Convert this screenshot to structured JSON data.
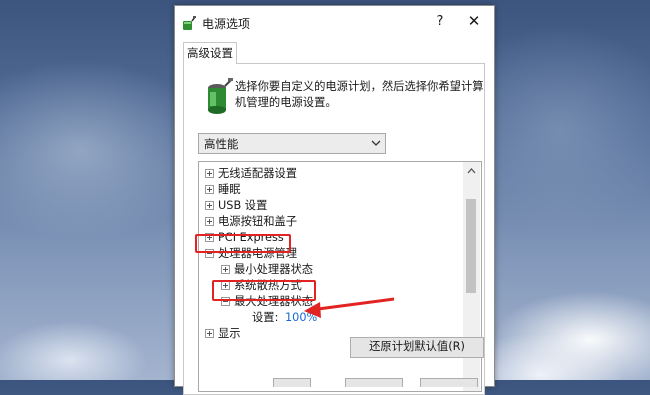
{
  "window": {
    "title": "电源选项",
    "help_label": "?",
    "close_label": "✕",
    "icon": "power-options-icon"
  },
  "tab": {
    "label": "高级设置"
  },
  "description": "选择你要自定义的电源计划，然后选择你希望计算机管理的电源设置。",
  "plan_select": {
    "value": "高性能"
  },
  "tree": {
    "items": [
      {
        "label": "无线适配器设置",
        "expander": "+"
      },
      {
        "label": "睡眠",
        "expander": "+"
      },
      {
        "label": "USB 设置",
        "expander": "+"
      },
      {
        "label": "电源按钮和盖子",
        "expander": "+"
      },
      {
        "label": "PCI Express",
        "expander": "+"
      },
      {
        "label": "处理器电源管理",
        "expander": "−"
      },
      {
        "label": "最小处理器状态",
        "expander": "+"
      },
      {
        "label": "系统散热方式",
        "expander": "+"
      },
      {
        "label": "最大处理器状态",
        "expander": "−"
      },
      {
        "label": "设置:",
        "value": "100%"
      },
      {
        "label": "显示",
        "expander": "+"
      }
    ]
  },
  "buttons": {
    "restore_defaults": "还原计划默认值(R)"
  },
  "colors": {
    "highlight_box": "#e32222",
    "annotation_arrow": "#e32222",
    "link_value": "#1a68d6"
  }
}
